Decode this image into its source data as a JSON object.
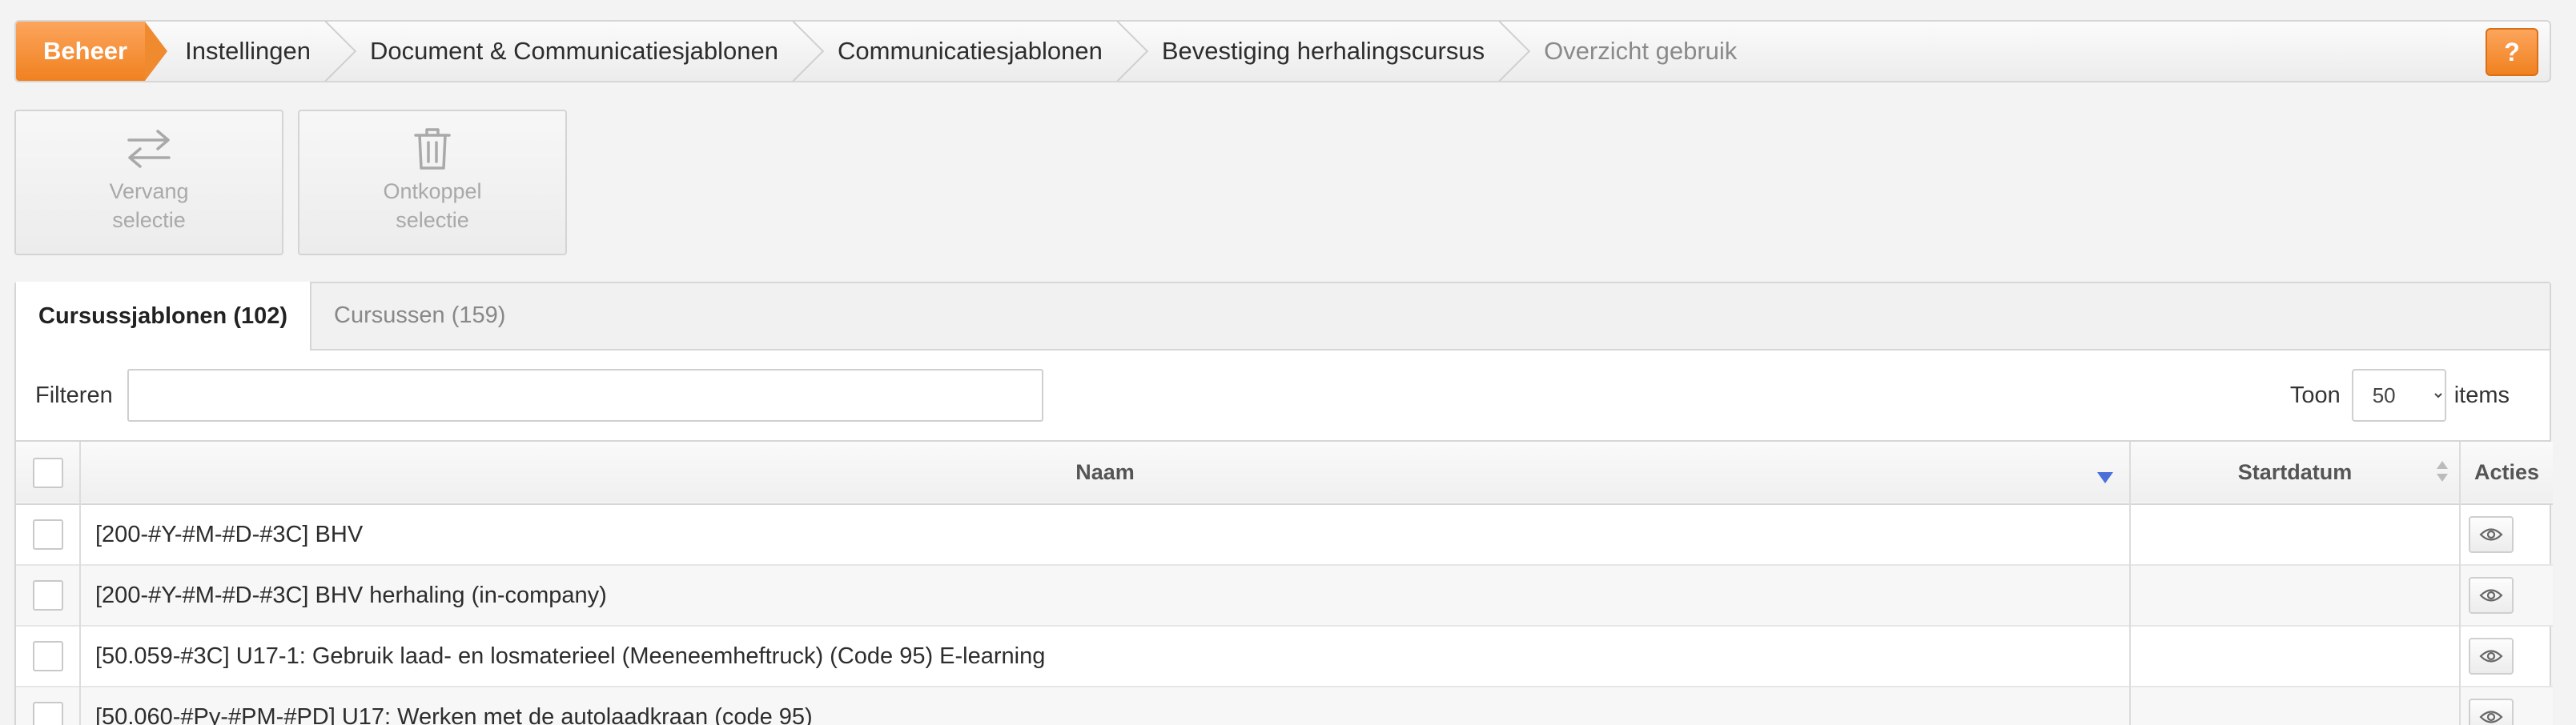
{
  "breadcrumb": {
    "items": [
      "Beheer",
      "Instellingen",
      "Document & Communicatiesjablonen",
      "Communicatiesjablonen",
      "Bevestiging herhalingscursus",
      "Overzicht gebruik"
    ],
    "help_label": "?"
  },
  "actions": {
    "replace_label": "Vervang selectie",
    "unlink_label": "Ontkoppel selectie"
  },
  "tabs": [
    {
      "label": "Cursussjablonen (102)",
      "active": true
    },
    {
      "label": "Cursussen (159)",
      "active": false
    }
  ],
  "filter": {
    "label": "Filteren",
    "value": "",
    "show_label": "Toon",
    "show_value": "50",
    "items_label": "items"
  },
  "table": {
    "columns": [
      "Naam",
      "Startdatum",
      "Acties"
    ],
    "rows": [
      {
        "naam": "[200-#Y-#M-#D-#3C] BHV",
        "startdatum": ""
      },
      {
        "naam": "[200-#Y-#M-#D-#3C] BHV herhaling (in-company)",
        "startdatum": ""
      },
      {
        "naam": "[50.059-#3C] U17-1: Gebruik laad- en losmaterieel (Meeneemheftruck) (Code 95) E-learning",
        "startdatum": ""
      },
      {
        "naam": "[50.060-#Py-#PM-#PD] U17: Werken met de autolaadkraan (code 95)",
        "startdatum": ""
      }
    ]
  },
  "colors": {
    "accent_orange": "#f08120",
    "sort_active": "#4a6fd8"
  }
}
